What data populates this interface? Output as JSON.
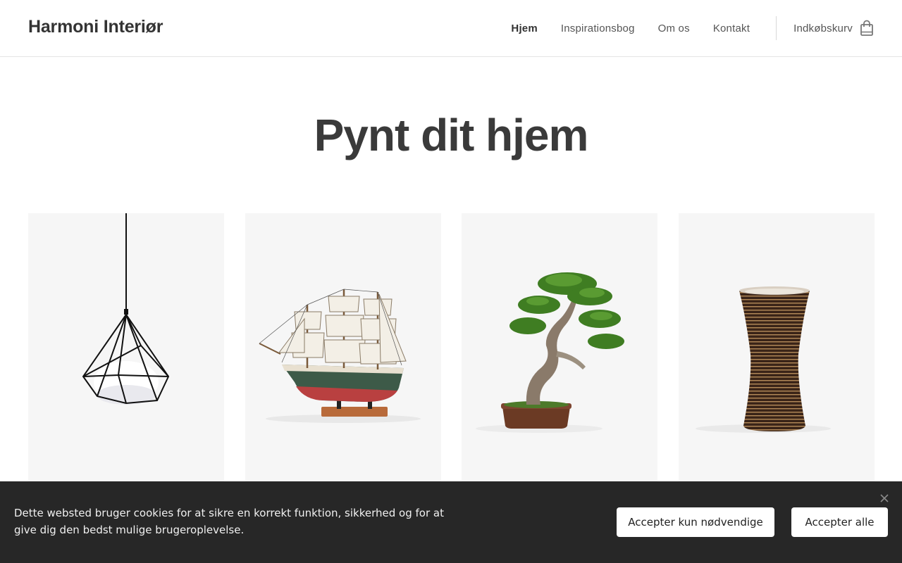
{
  "header": {
    "logo": "Harmoni Interiør",
    "nav": [
      {
        "label": "Hjem",
        "active": true
      },
      {
        "label": "Inspirationsbog"
      },
      {
        "label": "Om os"
      },
      {
        "label": "Kontakt"
      }
    ],
    "cart_label": "Indkøbskurv",
    "cart_icon": "shopping-bag-icon"
  },
  "main": {
    "title": "Pynt dit hjem",
    "products": [
      {
        "image": "pendant-lamp"
      },
      {
        "image": "model-sailing-ship"
      },
      {
        "image": "bonsai-tree"
      },
      {
        "image": "striped-vase"
      }
    ]
  },
  "cookie_banner": {
    "text": "Dette websted bruger cookies for at sikre en korrekt funktion, sikkerhed og for at give dig den bedst mulige brugeroplevelse.",
    "necessary_label": "Accepter kun nødvendige",
    "accept_all_label": "Accepter alle",
    "close_icon": "close-icon"
  },
  "colors": {
    "text": "#333333",
    "card_bg": "#f6f6f6",
    "cookie_bg": "#272727"
  }
}
